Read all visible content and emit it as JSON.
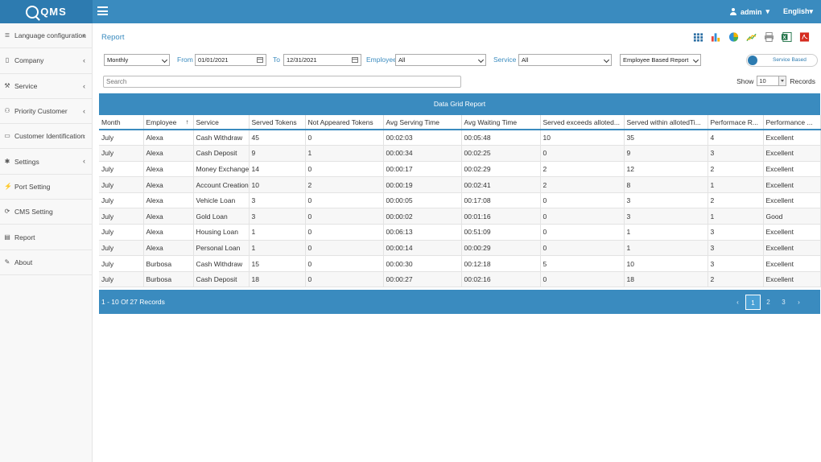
{
  "app": {
    "logo_text": "QMS"
  },
  "topbar": {
    "user": "admin",
    "language": "English"
  },
  "sidebar": {
    "items": [
      {
        "label": "Language configuration",
        "icon": "database-icon",
        "chevron": true
      },
      {
        "label": "Company",
        "icon": "building-icon",
        "chevron": true
      },
      {
        "label": "Service",
        "icon": "wrench-icon",
        "chevron": true
      },
      {
        "label": "Priority Customer",
        "icon": "users-icon",
        "chevron": true
      },
      {
        "label": "Customer Identification",
        "icon": "id-card-icon",
        "chevron": true
      },
      {
        "label": "Settings",
        "icon": "gear-icon",
        "chevron": true
      },
      {
        "label": "Port Setting",
        "icon": "plug-icon",
        "chevron": false
      },
      {
        "label": "CMS Setting",
        "icon": "sync-icon",
        "chevron": false
      },
      {
        "label": "Report",
        "icon": "file-icon",
        "chevron": false
      },
      {
        "label": "About",
        "icon": "edit-icon",
        "chevron": false
      }
    ]
  },
  "page": {
    "title": "Report"
  },
  "filters": {
    "period": "Monthly",
    "from_label": "From",
    "from_date": "01/01/2021",
    "to_label": "To",
    "to_date": "12/31/2021",
    "employee_label": "Employee",
    "employee": "All",
    "service_label": "Service",
    "service": "All",
    "report_type": "Employee Based Report",
    "toggle_label": "Service Based"
  },
  "search": {
    "placeholder": "Search"
  },
  "show": {
    "label": "Show",
    "value": "10",
    "suffix": "Records"
  },
  "grid": {
    "title": "Data Grid Report",
    "columns": [
      "Month",
      "Employee",
      "Service",
      "Served Tokens",
      "Not Appeared Tokens",
      "Avg Serving Time",
      "Avg Waiting Time",
      "Served exceeds alloted...",
      "Served within allotedTi...",
      "Performace R...",
      "Performance ..."
    ],
    "rows": [
      [
        "July",
        "Alexa",
        "Cash Withdraw",
        "45",
        "0",
        "00:02:03",
        "00:05:48",
        "10",
        "35",
        "4",
        "Excellent"
      ],
      [
        "July",
        "Alexa",
        "Cash Deposit",
        "9",
        "1",
        "00:00:34",
        "00:02:25",
        "0",
        "9",
        "3",
        "Excellent"
      ],
      [
        "July",
        "Alexa",
        "Money Exchange",
        "14",
        "0",
        "00:00:17",
        "00:02:29",
        "2",
        "12",
        "2",
        "Excellent"
      ],
      [
        "July",
        "Alexa",
        "Account Creation",
        "10",
        "2",
        "00:00:19",
        "00:02:41",
        "2",
        "8",
        "1",
        "Excellent"
      ],
      [
        "July",
        "Alexa",
        "Vehicle Loan",
        "3",
        "0",
        "00:00:05",
        "00:17:08",
        "0",
        "3",
        "2",
        "Excellent"
      ],
      [
        "July",
        "Alexa",
        "Gold Loan",
        "3",
        "0",
        "00:00:02",
        "00:01:16",
        "0",
        "3",
        "1",
        "Good"
      ],
      [
        "July",
        "Alexa",
        "Housing Loan",
        "1",
        "0",
        "00:06:13",
        "00:51:09",
        "0",
        "1",
        "3",
        "Excellent"
      ],
      [
        "July",
        "Alexa",
        "Personal Loan",
        "1",
        "0",
        "00:00:14",
        "00:00:29",
        "0",
        "1",
        "3",
        "Excellent"
      ],
      [
        "July",
        "Burbosa",
        "Cash Withdraw",
        "15",
        "0",
        "00:00:30",
        "00:12:18",
        "5",
        "10",
        "3",
        "Excellent"
      ],
      [
        "July",
        "Burbosa",
        "Cash Deposit",
        "18",
        "0",
        "00:00:27",
        "00:02:16",
        "0",
        "18",
        "2",
        "Excellent"
      ]
    ],
    "footer_text": "1 - 10 Of 27 Records",
    "pages": [
      "1",
      "2",
      "3"
    ],
    "prev": "‹",
    "next": "›"
  }
}
